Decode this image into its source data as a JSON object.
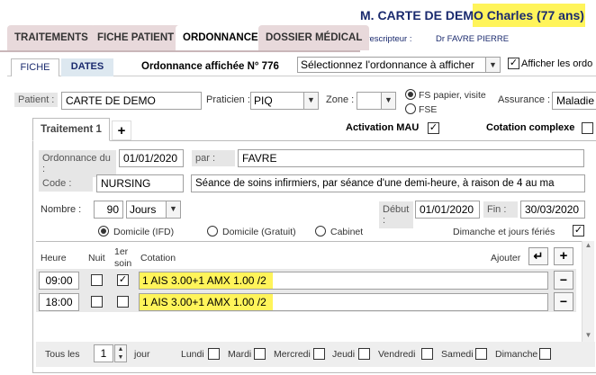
{
  "header": {
    "patient_title": "M. CARTE DE DEMO Charles",
    "patient_age": "(77 ans)",
    "prescripteur_label": "Prescripteur :",
    "prescripteur_value": "Dr FAVRE PIERRE"
  },
  "main_tabs": [
    "TRAITEMENTS",
    "FICHE PATIENT",
    "ORDONNANCES",
    "DOSSIER MÉDICAL"
  ],
  "sub_tabs": [
    "FICHE",
    "DATES"
  ],
  "ordonnance": {
    "title": "Ordonnance affichée N° 776",
    "select_value": "Sélectionnez l'ordonnance à afficher",
    "afficher_label": "Afficher les ordo"
  },
  "patient_row": {
    "patient_label": "Patient :",
    "patient_value": "CARTE DE DEMO",
    "praticien_label": "Praticien :",
    "praticien_value": "PIQ",
    "zone_label": "Zone :",
    "zone_value": "",
    "fs_papier": "FS papier, visite",
    "fse": "FSE",
    "assurance_label": "Assurance :",
    "assurance_value": "Maladie"
  },
  "traitement": {
    "tab_label": "Traitement 1",
    "add_tab": "+",
    "activation_mau": "Activation MAU",
    "cotation_complexe": "Cotation complexe",
    "ordonnance_du_label": "Ordonnance du :",
    "ordonnance_du_value": "01/01/2020",
    "par_label": "par :",
    "par_value": "FAVRE",
    "code_label": "Code :",
    "code_value": "NURSING",
    "description": "Séance de soins infirmiers, par séance d'une demi-heure, à raison de 4 au ma",
    "nombre_label": "Nombre :",
    "nombre_value": "90",
    "unit_value": "Jours",
    "debut_label": "Début :",
    "debut_value": "01/01/2020",
    "fin_label": "Fin :",
    "fin_value": "30/03/2020",
    "lieu_options": [
      "Domicile (IFD)",
      "Domicile (Gratuit)",
      "Cabinet"
    ],
    "dimanche_label": "Dimanche et jours fériés"
  },
  "table": {
    "headers": {
      "heure": "Heure",
      "nuit": "Nuit",
      "premier_soin": "1er soin",
      "cotation": "Cotation",
      "ajouter": "Ajouter"
    },
    "rows": [
      {
        "heure": "09:00",
        "nuit": false,
        "premier_soin": true,
        "cotation": "1 AIS 3.00+1 AMX  1.00 /2"
      },
      {
        "heure": "18:00",
        "nuit": false,
        "premier_soin": false,
        "cotation": "1 AIS 3.00+1 AMX  1.00 /2"
      }
    ],
    "remove_symbol": "−",
    "add_symbol": "+"
  },
  "footer": {
    "tous_les": "Tous les",
    "tous_les_value": "1",
    "jour": "jour",
    "days": [
      "Lundi",
      "Mardi",
      "Mercredi",
      "Jeudi",
      "Vendredi",
      "Samedi",
      "Dimanche"
    ]
  },
  "colors": {
    "highlight": "#fff45a",
    "tab_bg": "#e8d9db",
    "title_blue": "#1a2a6e"
  }
}
